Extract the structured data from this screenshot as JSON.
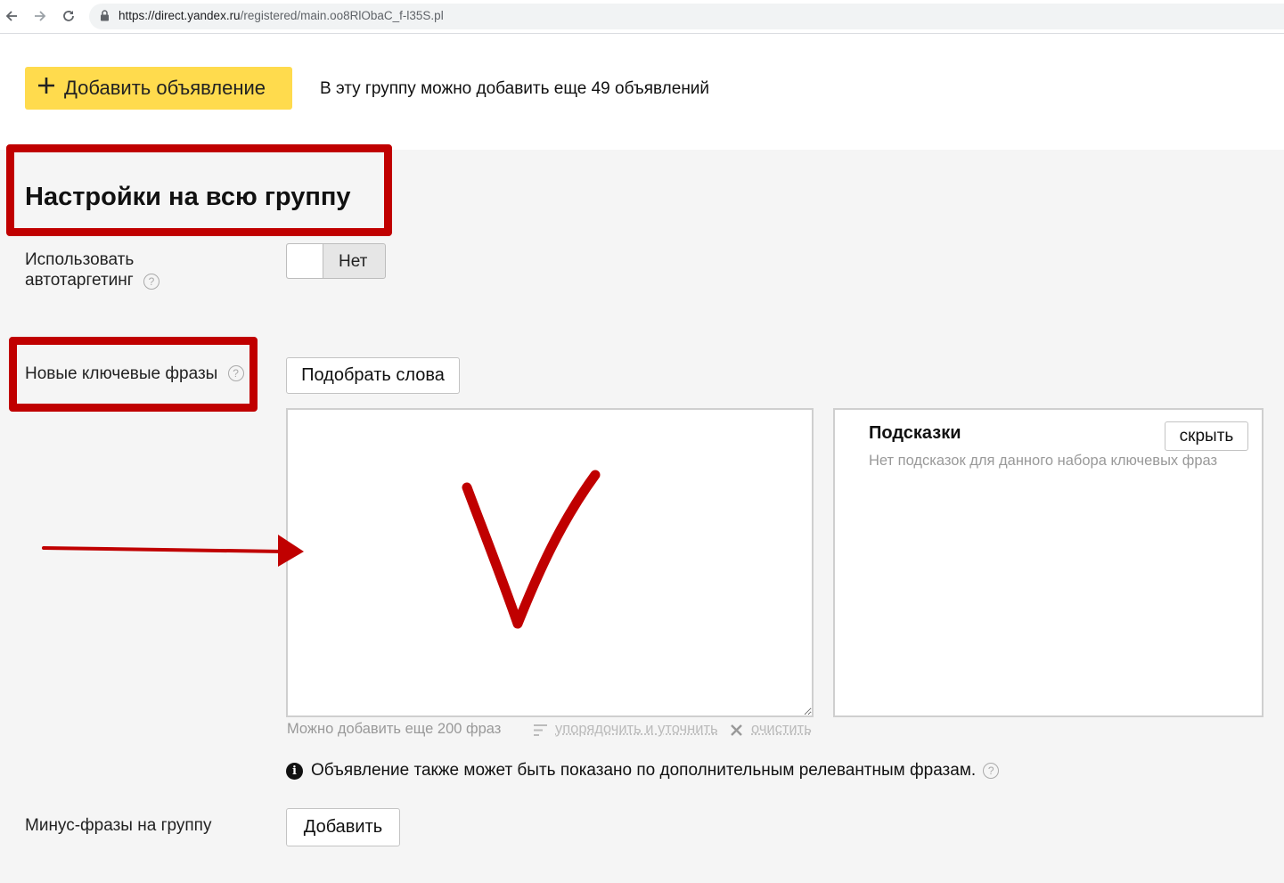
{
  "browser": {
    "url_host": "https://direct.yandex.ru",
    "url_path": "/registered/main.oo8RlObaC_f-l35S.pl"
  },
  "header": {
    "add_ad_label": "Добавить объявление",
    "limit_note": "В эту группу можно добавить еще 49 объявлений"
  },
  "group_settings": {
    "title": "Настройки на всю группу",
    "autotargeting_label_line1": "Использовать",
    "autotargeting_label_line2": "автотаргетинг",
    "autotargeting_toggle_value": "Нет",
    "keywords_label": "Новые ключевые фразы",
    "pick_words_button": "Подобрать слова",
    "keywords_value": "",
    "keywords_remaining": "Можно добавить еще 200 фраз",
    "sort_refine_link": "упорядочить и уточнить",
    "clear_link": "очистить",
    "hints_title": "Подсказки",
    "hints_hide_button": "скрыть",
    "hints_empty": "Нет подсказок для данного набора ключевых фраз",
    "info_note": "Объявление также может быть показано по дополнительным релевантным фразам.",
    "negative_label": "Минус-фразы на группу",
    "negative_add_button": "Добавить"
  },
  "colors": {
    "accent_yellow": "#ffdb4d",
    "annotation_red": "#c00000",
    "panel_bg": "#f5f5f5"
  },
  "icons": [
    "back-arrow-icon",
    "forward-arrow-icon",
    "reload-icon",
    "lock-icon",
    "plus-icon",
    "help-icon",
    "sort-icon",
    "clear-icon",
    "info-icon"
  ]
}
